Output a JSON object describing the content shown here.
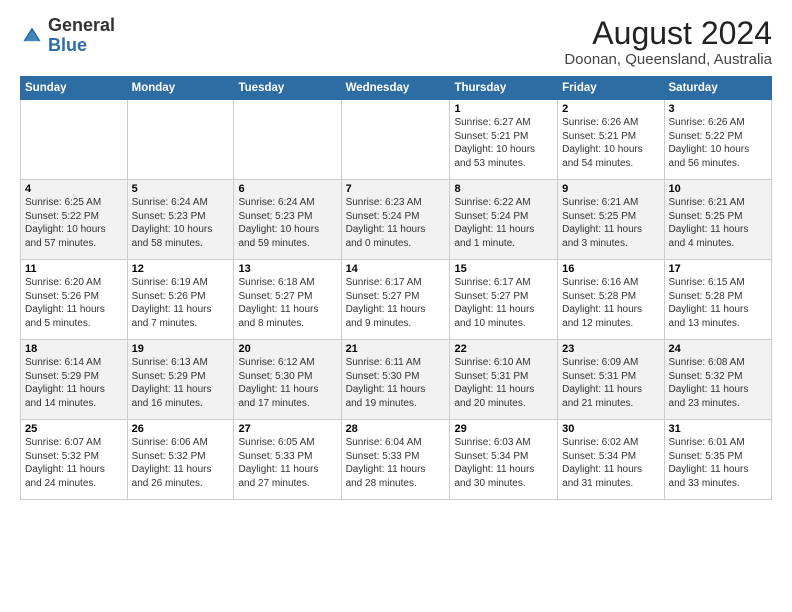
{
  "header": {
    "logo_general": "General",
    "logo_blue": "Blue",
    "month_year": "August 2024",
    "location": "Doonan, Queensland, Australia"
  },
  "days_of_week": [
    "Sunday",
    "Monday",
    "Tuesday",
    "Wednesday",
    "Thursday",
    "Friday",
    "Saturday"
  ],
  "weeks": [
    [
      {
        "day": "",
        "info": ""
      },
      {
        "day": "",
        "info": ""
      },
      {
        "day": "",
        "info": ""
      },
      {
        "day": "",
        "info": ""
      },
      {
        "day": "1",
        "info": "Sunrise: 6:27 AM\nSunset: 5:21 PM\nDaylight: 10 hours\nand 53 minutes."
      },
      {
        "day": "2",
        "info": "Sunrise: 6:26 AM\nSunset: 5:21 PM\nDaylight: 10 hours\nand 54 minutes."
      },
      {
        "day": "3",
        "info": "Sunrise: 6:26 AM\nSunset: 5:22 PM\nDaylight: 10 hours\nand 56 minutes."
      }
    ],
    [
      {
        "day": "4",
        "info": "Sunrise: 6:25 AM\nSunset: 5:22 PM\nDaylight: 10 hours\nand 57 minutes."
      },
      {
        "day": "5",
        "info": "Sunrise: 6:24 AM\nSunset: 5:23 PM\nDaylight: 10 hours\nand 58 minutes."
      },
      {
        "day": "6",
        "info": "Sunrise: 6:24 AM\nSunset: 5:23 PM\nDaylight: 10 hours\nand 59 minutes."
      },
      {
        "day": "7",
        "info": "Sunrise: 6:23 AM\nSunset: 5:24 PM\nDaylight: 11 hours\nand 0 minutes."
      },
      {
        "day": "8",
        "info": "Sunrise: 6:22 AM\nSunset: 5:24 PM\nDaylight: 11 hours\nand 1 minute."
      },
      {
        "day": "9",
        "info": "Sunrise: 6:21 AM\nSunset: 5:25 PM\nDaylight: 11 hours\nand 3 minutes."
      },
      {
        "day": "10",
        "info": "Sunrise: 6:21 AM\nSunset: 5:25 PM\nDaylight: 11 hours\nand 4 minutes."
      }
    ],
    [
      {
        "day": "11",
        "info": "Sunrise: 6:20 AM\nSunset: 5:26 PM\nDaylight: 11 hours\nand 5 minutes."
      },
      {
        "day": "12",
        "info": "Sunrise: 6:19 AM\nSunset: 5:26 PM\nDaylight: 11 hours\nand 7 minutes."
      },
      {
        "day": "13",
        "info": "Sunrise: 6:18 AM\nSunset: 5:27 PM\nDaylight: 11 hours\nand 8 minutes."
      },
      {
        "day": "14",
        "info": "Sunrise: 6:17 AM\nSunset: 5:27 PM\nDaylight: 11 hours\nand 9 minutes."
      },
      {
        "day": "15",
        "info": "Sunrise: 6:17 AM\nSunset: 5:27 PM\nDaylight: 11 hours\nand 10 minutes."
      },
      {
        "day": "16",
        "info": "Sunrise: 6:16 AM\nSunset: 5:28 PM\nDaylight: 11 hours\nand 12 minutes."
      },
      {
        "day": "17",
        "info": "Sunrise: 6:15 AM\nSunset: 5:28 PM\nDaylight: 11 hours\nand 13 minutes."
      }
    ],
    [
      {
        "day": "18",
        "info": "Sunrise: 6:14 AM\nSunset: 5:29 PM\nDaylight: 11 hours\nand 14 minutes."
      },
      {
        "day": "19",
        "info": "Sunrise: 6:13 AM\nSunset: 5:29 PM\nDaylight: 11 hours\nand 16 minutes."
      },
      {
        "day": "20",
        "info": "Sunrise: 6:12 AM\nSunset: 5:30 PM\nDaylight: 11 hours\nand 17 minutes."
      },
      {
        "day": "21",
        "info": "Sunrise: 6:11 AM\nSunset: 5:30 PM\nDaylight: 11 hours\nand 19 minutes."
      },
      {
        "day": "22",
        "info": "Sunrise: 6:10 AM\nSunset: 5:31 PM\nDaylight: 11 hours\nand 20 minutes."
      },
      {
        "day": "23",
        "info": "Sunrise: 6:09 AM\nSunset: 5:31 PM\nDaylight: 11 hours\nand 21 minutes."
      },
      {
        "day": "24",
        "info": "Sunrise: 6:08 AM\nSunset: 5:32 PM\nDaylight: 11 hours\nand 23 minutes."
      }
    ],
    [
      {
        "day": "25",
        "info": "Sunrise: 6:07 AM\nSunset: 5:32 PM\nDaylight: 11 hours\nand 24 minutes."
      },
      {
        "day": "26",
        "info": "Sunrise: 6:06 AM\nSunset: 5:32 PM\nDaylight: 11 hours\nand 26 minutes."
      },
      {
        "day": "27",
        "info": "Sunrise: 6:05 AM\nSunset: 5:33 PM\nDaylight: 11 hours\nand 27 minutes."
      },
      {
        "day": "28",
        "info": "Sunrise: 6:04 AM\nSunset: 5:33 PM\nDaylight: 11 hours\nand 28 minutes."
      },
      {
        "day": "29",
        "info": "Sunrise: 6:03 AM\nSunset: 5:34 PM\nDaylight: 11 hours\nand 30 minutes."
      },
      {
        "day": "30",
        "info": "Sunrise: 6:02 AM\nSunset: 5:34 PM\nDaylight: 11 hours\nand 31 minutes."
      },
      {
        "day": "31",
        "info": "Sunrise: 6:01 AM\nSunset: 5:35 PM\nDaylight: 11 hours\nand 33 minutes."
      }
    ]
  ]
}
